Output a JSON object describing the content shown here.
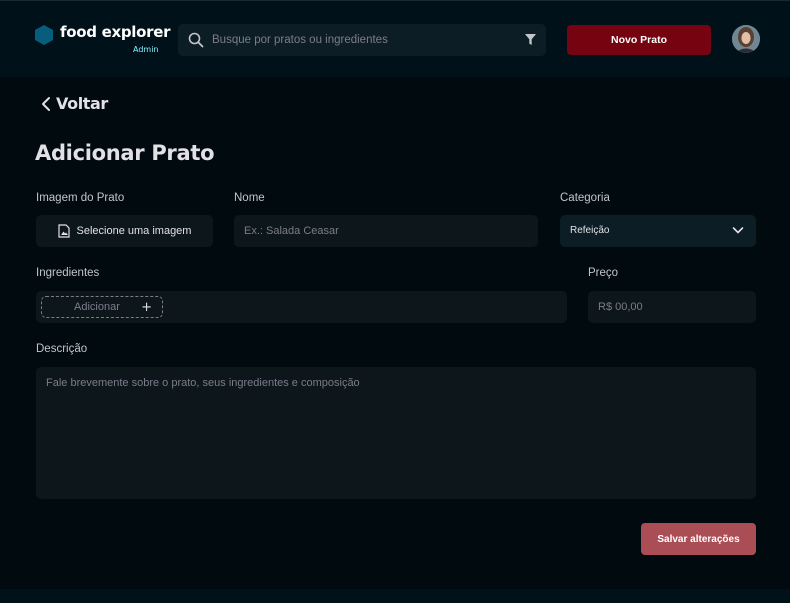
{
  "header": {
    "brand_name": "food explorer",
    "brand_badge": "Admin",
    "search_placeholder": "Busque por pratos ou ingredientes",
    "new_dish_label": "Novo Prato",
    "icons": {
      "search": "search-icon",
      "filter": "filter-icon",
      "brand": "hexagon-logo-icon"
    }
  },
  "nav": {
    "back_label": "Voltar"
  },
  "page": {
    "title": "Adicionar Prato"
  },
  "form": {
    "image": {
      "label": "Imagem do Prato",
      "button_label": "Selecione uma imagem"
    },
    "name": {
      "label": "Nome",
      "placeholder": "Ex.: Salada Ceasar",
      "value": ""
    },
    "category": {
      "label": "Categoria",
      "selected": "Refeição"
    },
    "ingredients": {
      "label": "Ingredientes",
      "add_placeholder": "Adicionar",
      "add_symbol": "+"
    },
    "price": {
      "label": "Preço",
      "placeholder": "R$ 00,00",
      "value": ""
    },
    "description": {
      "label": "Descrição",
      "placeholder": "Fale brevemente sobre o prato, seus ingredientes e composição",
      "value": ""
    },
    "save_label": "Salvar alterações"
  },
  "colors": {
    "background": "#000A0F",
    "header": "#00111A",
    "accent_red": "#750310",
    "save_button": "#AB4D55",
    "admin_badge": "#82F3FF",
    "logo": "#065E7C"
  }
}
